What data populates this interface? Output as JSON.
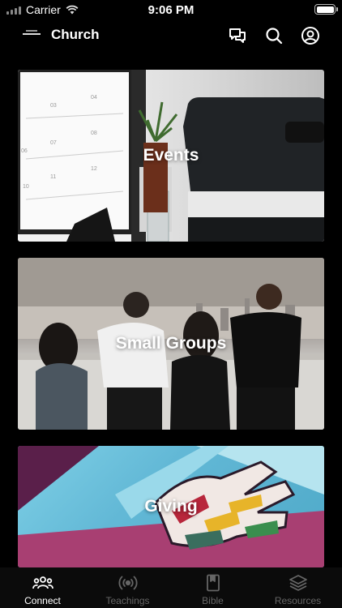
{
  "status_bar": {
    "carrier": "Carrier",
    "time": "9:06 PM"
  },
  "header": {
    "title": "Church",
    "icons": [
      "chat-icon",
      "search-icon",
      "profile-icon"
    ]
  },
  "cards": [
    {
      "label": "Events"
    },
    {
      "label": "Small Groups"
    },
    {
      "label": "Giving"
    }
  ],
  "tabs": [
    {
      "label": "Connect",
      "icon": "people-icon",
      "active": true
    },
    {
      "label": "Teachings",
      "icon": "broadcast-icon",
      "active": false
    },
    {
      "label": "Bible",
      "icon": "book-icon",
      "active": false
    },
    {
      "label": "Resources",
      "icon": "layers-icon",
      "active": false
    }
  ],
  "colors": {
    "background": "#000000",
    "tab_active": "#ffffff",
    "tab_inactive": "#666666"
  }
}
